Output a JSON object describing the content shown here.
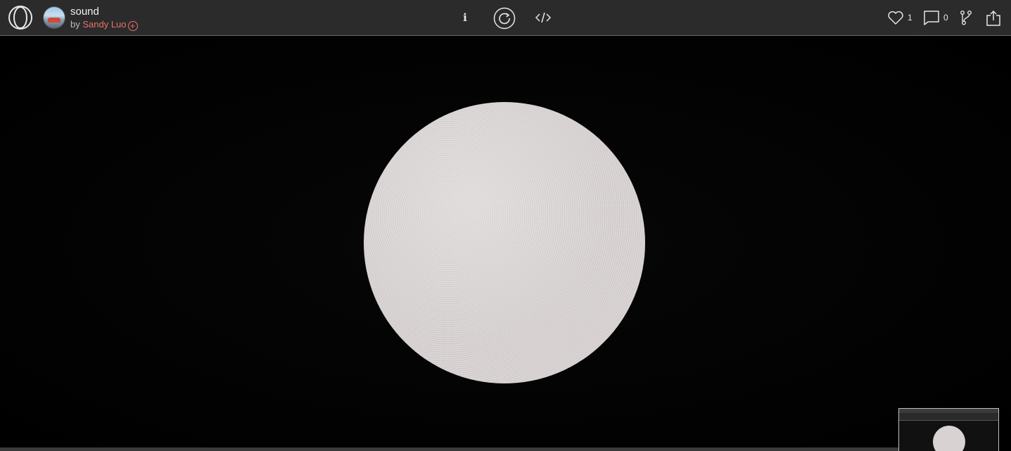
{
  "sketch": {
    "title": "sound",
    "by_prefix": "by",
    "author": "Sandy Luo",
    "follow_symbol": "+"
  },
  "toolbar": {
    "info_label": "i",
    "replay_icon": "replay-icon",
    "code_icon": "code-icon"
  },
  "stats": {
    "likes": "1",
    "comments": "0"
  },
  "icons": {
    "logo": "openprocessing-logo-icon",
    "heart": "heart-icon",
    "comment": "comment-icon",
    "fork": "fork-icon",
    "share": "share-icon"
  },
  "colors": {
    "topbar": "#2b2b2b",
    "author": "#e8706a",
    "canvas": "#000000",
    "moon": "#d8d3d2"
  }
}
